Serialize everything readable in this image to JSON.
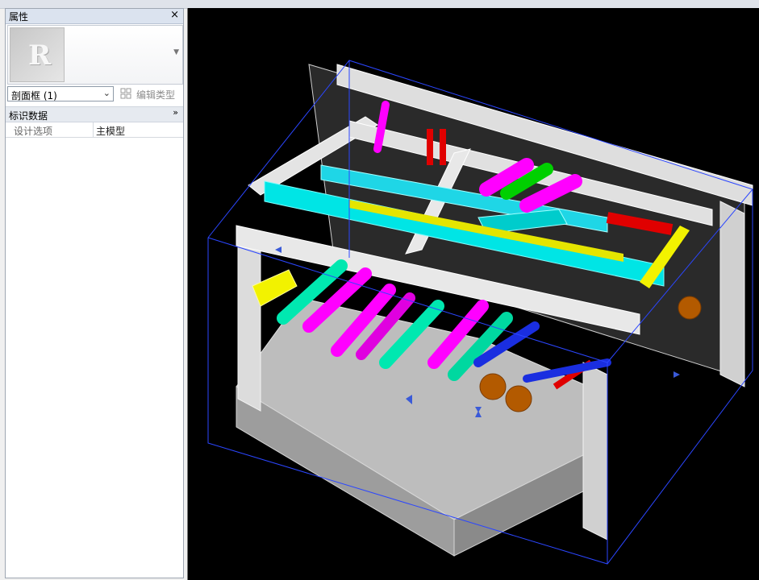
{
  "properties_panel": {
    "title": "属性",
    "close_glyph": "×",
    "type_selector": {
      "value": "剖面框 (1)",
      "dropdown_icon": "chevron-down-icon"
    },
    "edit_type_label": "编辑类型",
    "section": {
      "label": "标识数据",
      "collapse_icon": "chevron-up-double-icon"
    },
    "rows": [
      {
        "key": "设计选项",
        "value": "主模型"
      }
    ]
  },
  "viewport": {
    "background": "#000000",
    "colors": {
      "cyan": "#00e5e5",
      "magenta": "#ff00ff",
      "yellow": "#f2f200",
      "red": "#e00000",
      "green": "#00d000",
      "blue": "#1a2ee0",
      "orange": "#b35a00",
      "concrete": "#cfcfcf",
      "section_box": "#2b46ff"
    },
    "controls": [
      "section-box-arrow-left",
      "section-box-arrow-right",
      "section-box-arrow-front",
      "section-box-arrow-down",
      "section-box-arrow-top"
    ]
  }
}
